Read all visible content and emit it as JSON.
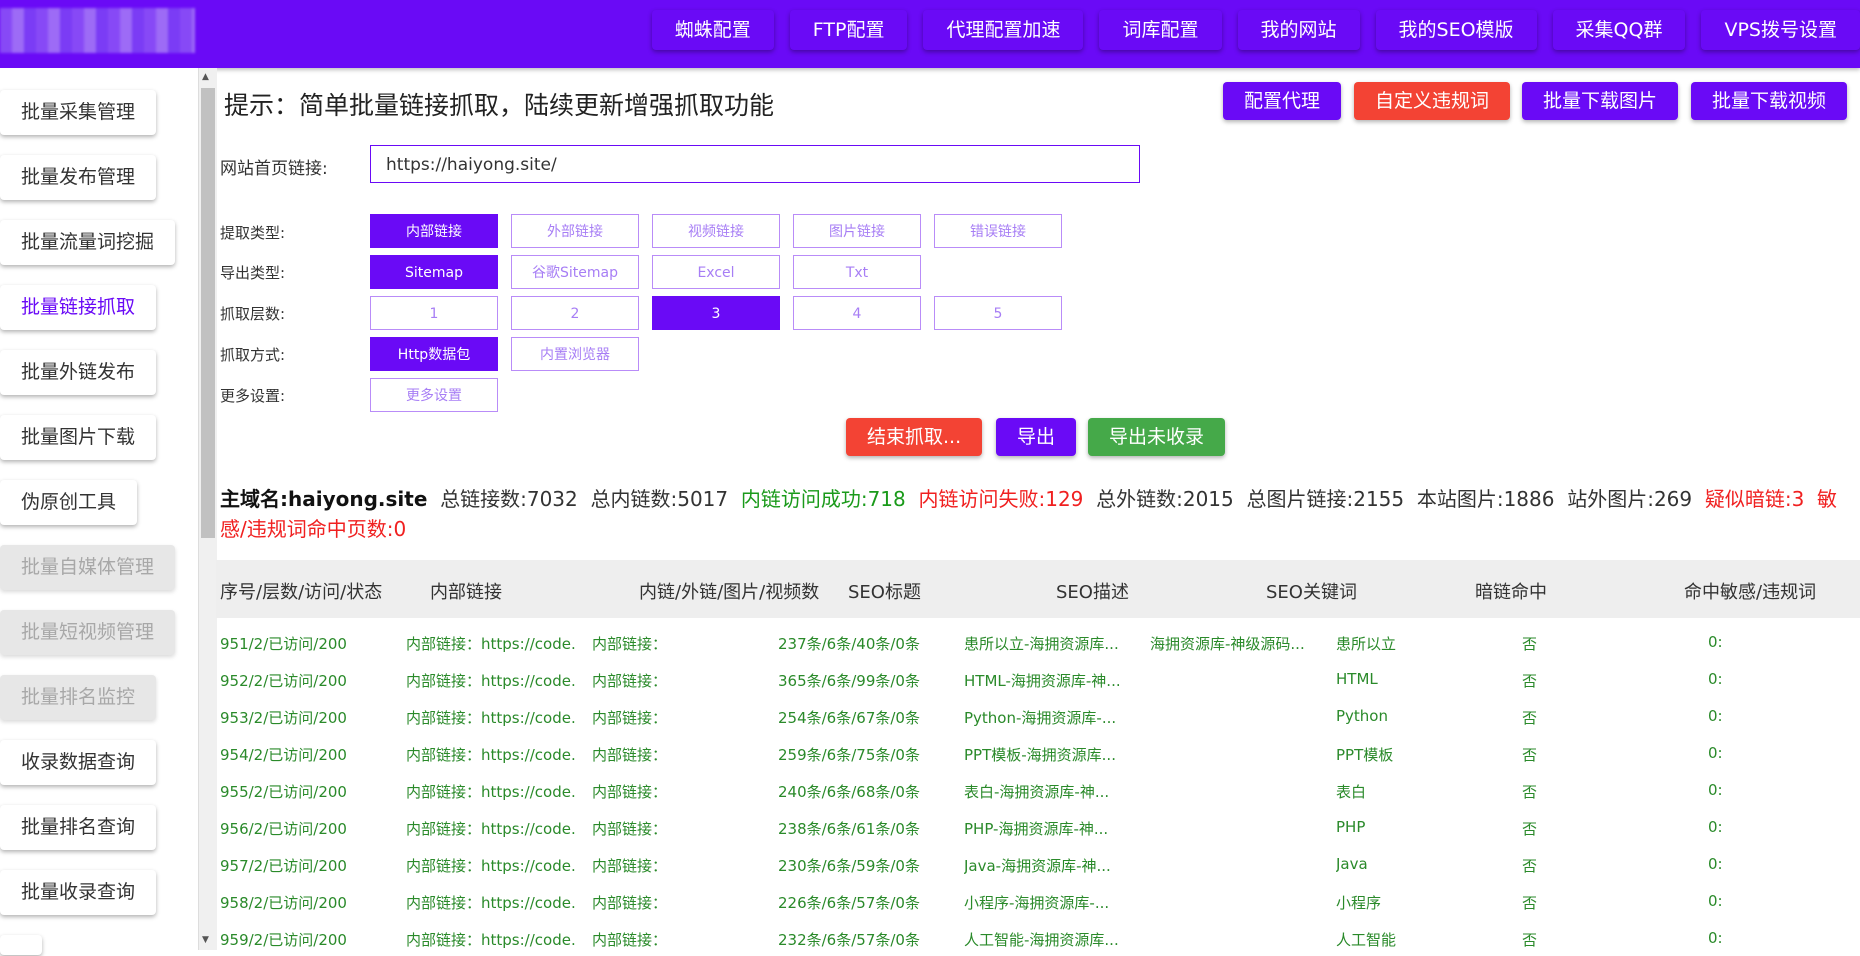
{
  "topbar": {
    "nav": [
      "蜘蛛配置",
      "FTP配置",
      "代理配置加速",
      "词库配置",
      "我的网站",
      "我的SEO模版",
      "采集QQ群",
      "VPS拨号设置"
    ]
  },
  "sidebar": {
    "items": [
      {
        "label": "批量采集管理",
        "state": "normal"
      },
      {
        "label": "批量发布管理",
        "state": "normal"
      },
      {
        "label": "批量流量词挖掘",
        "state": "normal"
      },
      {
        "label": "批量链接抓取",
        "state": "active"
      },
      {
        "label": "批量外链发布",
        "state": "normal"
      },
      {
        "label": "批量图片下载",
        "state": "normal"
      },
      {
        "label": "伪原创工具",
        "state": "normal"
      },
      {
        "label": "批量自媒体管理",
        "state": "disabled"
      },
      {
        "label": "批量短视频管理",
        "state": "disabled"
      },
      {
        "label": "批量排名监控",
        "state": "disabled"
      },
      {
        "label": "收录数据查询",
        "state": "normal"
      },
      {
        "label": "批量排名查询",
        "state": "normal"
      },
      {
        "label": "批量收录查询",
        "state": "normal"
      }
    ]
  },
  "main": {
    "tip": "提示：简单批量链接抓取，陆续更新增强抓取功能",
    "actions": {
      "proxy": "配置代理",
      "custom_rules": "自定义违规词",
      "download_images": "批量下载图片",
      "download_videos": "批量下载视频"
    },
    "url": {
      "label": "网站首页链接:",
      "value": "https://haiyong.site/"
    },
    "extract_type": {
      "label": "提取类型:",
      "options": [
        "内部链接",
        "外部链接",
        "视频链接",
        "图片链接",
        "错误链接"
      ],
      "selected": "内部链接"
    },
    "export_type": {
      "label": "导出类型:",
      "options": [
        "Sitemap",
        "谷歌Sitemap",
        "Excel",
        "Txt"
      ],
      "selected": "Sitemap"
    },
    "depth": {
      "label": "抓取层数:",
      "options": [
        "1",
        "2",
        "3",
        "4",
        "5"
      ],
      "selected": "3"
    },
    "method": {
      "label": "抓取方式:",
      "options": [
        "Http数据包",
        "内置浏览器"
      ],
      "selected": "Http数据包"
    },
    "more": {
      "label": "更多设置:",
      "button": "更多设置"
    },
    "controls": {
      "stop": "结束抓取...",
      "export": "导出",
      "export_unindexed": "导出未收录"
    },
    "stats": {
      "domain_label": "主域名:",
      "domain": "haiyong.site",
      "total_links": "总链接数:7032",
      "total_internal": "总内链数:5017",
      "internal_ok": "内链访问成功:718",
      "internal_fail": "内链访问失败:129",
      "total_external": "总外链数:2015",
      "total_images": "总图片链接:2155",
      "local_images": "本站图片:1886",
      "external_images": "站外图片:269",
      "dark_links": "疑似暗链:3",
      "sensitive": "敏感/违规词命中页数:0"
    },
    "table": {
      "headers": [
        "序号/层数/访问/状态",
        "内部链接",
        "内链/外链/图片/视频数",
        "SEO标题",
        "SEO描述",
        "SEO关键词",
        "暗链命中",
        "命中敏感/违规词"
      ],
      "rows": [
        [
          "951/2/已访问/200",
          "内部链接：https://code.ha",
          "内部链接：",
          "237条/6条/40条/0条",
          "患所以立-海拥资源库...",
          "海拥资源库-神级源码...",
          "患所以立",
          "否",
          "0:"
        ],
        [
          "952/2/已访问/200",
          "内部链接：https://code.ha",
          "内部链接：",
          "365条/6条/99条/0条",
          "HTML-海拥资源库-神...",
          "",
          "HTML",
          "否",
          "0:"
        ],
        [
          "953/2/已访问/200",
          "内部链接：https://code.ha",
          "内部链接：",
          "254条/6条/67条/0条",
          "Python-海拥资源库-...",
          "",
          "Python",
          "否",
          "0:"
        ],
        [
          "954/2/已访问/200",
          "内部链接：https://code.ha",
          "内部链接：",
          "259条/6条/75条/0条",
          "PPT模板-海拥资源库...",
          "",
          "PPT模板",
          "否",
          "0:"
        ],
        [
          "955/2/已访问/200",
          "内部链接：https://code.ha",
          "内部链接：",
          "240条/6条/68条/0条",
          "表白-海拥资源库-神...",
          "",
          "表白",
          "否",
          "0:"
        ],
        [
          "956/2/已访问/200",
          "内部链接：https://code.ha",
          "内部链接：",
          "238条/6条/61条/0条",
          "PHP-海拥资源库-神...",
          "",
          "PHP",
          "否",
          "0:"
        ],
        [
          "957/2/已访问/200",
          "内部链接：https://code.ha",
          "内部链接：",
          "230条/6条/59条/0条",
          "Java-海拥资源库-神...",
          "",
          "Java",
          "否",
          "0:"
        ],
        [
          "958/2/已访问/200",
          "内部链接：https://code.ha",
          "内部链接：",
          "226条/6条/57条/0条",
          "小程序-海拥资源库-...",
          "",
          "小程序",
          "否",
          "0:"
        ],
        [
          "959/2/已访问/200",
          "内部链接：https://code.ha",
          "内部链接：",
          "232条/6条/57条/0条",
          "人工智能-海拥资源库...",
          "",
          "人工智能",
          "否",
          "0:"
        ]
      ]
    }
  }
}
